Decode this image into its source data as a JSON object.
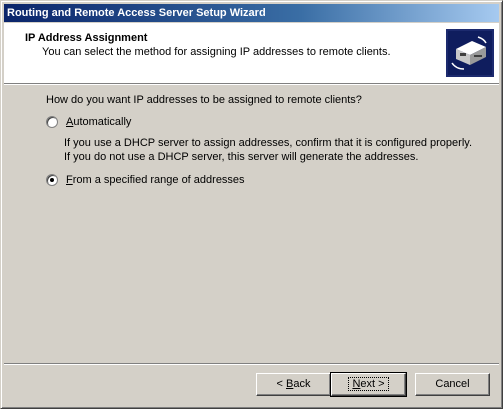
{
  "window": {
    "title": "Routing and Remote Access Server Setup Wizard"
  },
  "header": {
    "title": "IP Address Assignment",
    "subtitle": "You can select the method for assigning IP addresses to remote clients.",
    "icon": "network-wizard-icon"
  },
  "body": {
    "question": "How do you want IP addresses to be assigned to remote clients?",
    "options": [
      {
        "label_pre": "",
        "label_accel": "A",
        "label_post": "utomatically",
        "selected": false,
        "description": [
          "If you use a DHCP server to assign addresses, confirm that it is configured properly.",
          "If you do not use a DHCP server, this server will generate the addresses."
        ]
      },
      {
        "label_pre": "",
        "label_accel": "F",
        "label_post": "rom a specified range of addresses",
        "selected": true,
        "description": []
      }
    ]
  },
  "buttons": {
    "back_pre": "< ",
    "back_accel": "B",
    "back_post": "ack",
    "next_pre": "",
    "next_accel": "N",
    "next_post": "ext >",
    "cancel": "Cancel"
  },
  "colors": {
    "titlebar_start": "#0a246a",
    "titlebar_end": "#a6caf0",
    "dialog_face": "#d4d0c8",
    "header_bg": "#ffffff"
  }
}
